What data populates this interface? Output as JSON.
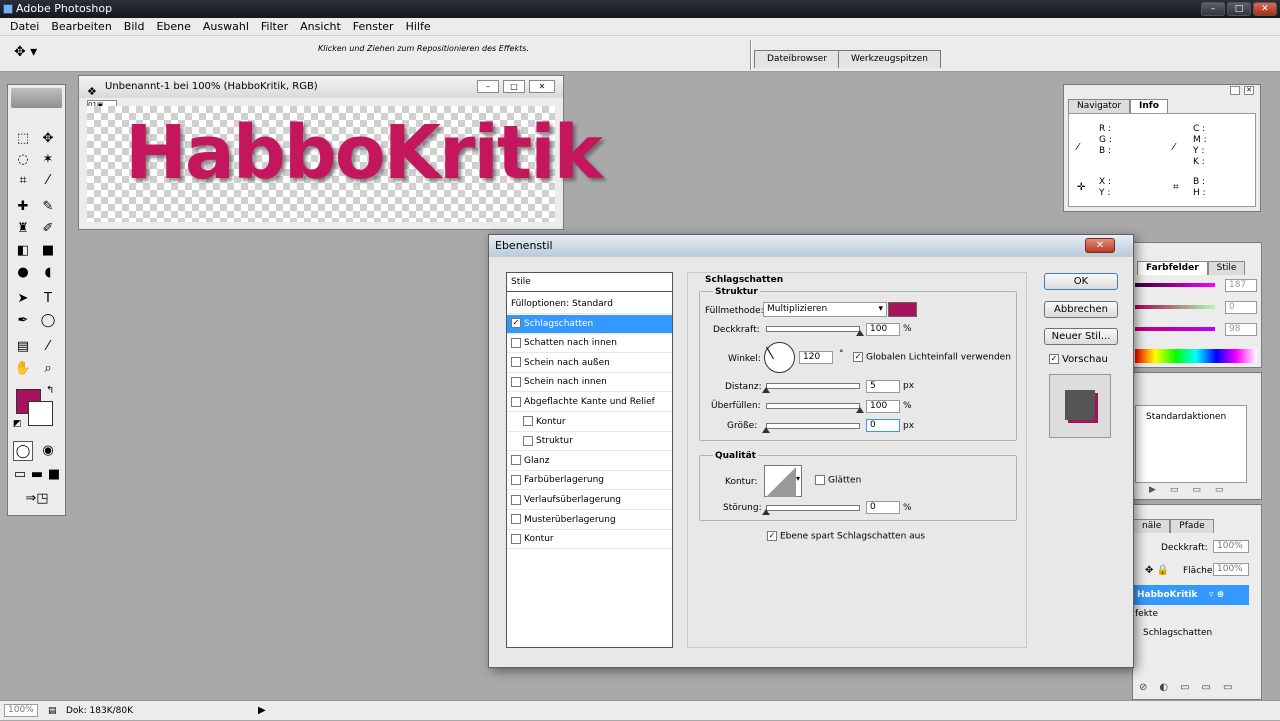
{
  "app": {
    "title": "Adobe Photoshop"
  },
  "menu": [
    "Datei",
    "Bearbeiten",
    "Bild",
    "Ebene",
    "Auswahl",
    "Filter",
    "Ansicht",
    "Fenster",
    "Hilfe"
  ],
  "options_bar": {
    "hint": "Klicken und Ziehen zum Repositionieren des Effekts.",
    "well_tabs": [
      "Dateibrowser",
      "Werkzeugspitzen"
    ]
  },
  "colors": {
    "foreground": "#a5135d",
    "background": "#ffffff",
    "accent": "#3399ff"
  },
  "document": {
    "title": "Unbenannt-1 bei 100% (HabboKritik, RGB)",
    "canvas_text": "HabboKritik"
  },
  "info_palette": {
    "tabs": [
      "Navigator",
      "Info"
    ],
    "left_rgb": [
      "R :",
      "G :",
      "B :"
    ],
    "right_cmyk": [
      "C :",
      "M :",
      "Y :",
      "K :"
    ],
    "xy": [
      "X :",
      "Y :"
    ],
    "bh": [
      "B :",
      "H :"
    ]
  },
  "color_palette": {
    "tabs": [
      "Farbfelder",
      "Stile"
    ],
    "values": [
      "187",
      "0",
      "98"
    ]
  },
  "actions_palette": {
    "item": "Standardaktionen"
  },
  "layers_palette": {
    "tabs": [
      "näle",
      "Pfade"
    ],
    "opacity_label": "Deckkraft:",
    "opacity": "100%",
    "fill_label": "Fläche",
    "fill": "100%",
    "layer_name": "HabboKritik",
    "effects_label": "fekte",
    "effect_item": "Schlagschatten"
  },
  "status_bar": {
    "zoom": "100%",
    "doc": "Dok: 183K/80K"
  },
  "dialog": {
    "title": "Ebenenstil",
    "styles_header": "Stile",
    "styles": [
      {
        "label": "Fülloptionen: Standard",
        "checkbox": false,
        "checked": false,
        "selected": false,
        "indent": false
      },
      {
        "label": "Schlagschatten",
        "checkbox": true,
        "checked": true,
        "selected": true,
        "indent": false
      },
      {
        "label": "Schatten nach innen",
        "checkbox": true,
        "checked": false,
        "selected": false,
        "indent": false
      },
      {
        "label": "Schein nach außen",
        "checkbox": true,
        "checked": false,
        "selected": false,
        "indent": false
      },
      {
        "label": "Schein nach innen",
        "checkbox": true,
        "checked": false,
        "selected": false,
        "indent": false
      },
      {
        "label": "Abgeflachte Kante und Relief",
        "checkbox": true,
        "checked": false,
        "selected": false,
        "indent": false
      },
      {
        "label": "Kontur",
        "checkbox": true,
        "checked": false,
        "selected": false,
        "indent": true
      },
      {
        "label": "Struktur",
        "checkbox": true,
        "checked": false,
        "selected": false,
        "indent": true
      },
      {
        "label": "Glanz",
        "checkbox": true,
        "checked": false,
        "selected": false,
        "indent": false
      },
      {
        "label": "Farbüberlagerung",
        "checkbox": true,
        "checked": false,
        "selected": false,
        "indent": false
      },
      {
        "label": "Verlaufsüberlagerung",
        "checkbox": true,
        "checked": false,
        "selected": false,
        "indent": false
      },
      {
        "label": "Musterüberlagerung",
        "checkbox": true,
        "checked": false,
        "selected": false,
        "indent": false
      },
      {
        "label": "Kontur",
        "checkbox": true,
        "checked": false,
        "selected": false,
        "indent": false
      }
    ],
    "section_title": "Schlagschatten",
    "struktur": {
      "title": "Struktur",
      "blend_label": "Füllmethode:",
      "blend_value": "Multiplizieren",
      "shadow_color": "#a5135d",
      "opacity_label": "Deckkraft:",
      "opacity_value": "100",
      "opacity": 1.0,
      "angle_label": "Winkel:",
      "angle_value": "120",
      "angle_unit": "°",
      "global_light_label": "Globalen Lichteinfall verwenden",
      "distance_label": "Distanz:",
      "distance_value": "5",
      "distance": 0.0,
      "spread_label": "Überfüllen:",
      "spread_value": "100",
      "spread": 1.0,
      "size_label": "Größe:",
      "size_value": "0",
      "size": 0.0,
      "unit_px": "px",
      "unit_pct": "%"
    },
    "qualitaet": {
      "title": "Qualität",
      "contour_label": "Kontur:",
      "smooth_label": "Glätten",
      "noise_label": "Störung:",
      "noise_value": "0",
      "noise": 0.0,
      "unit_pct": "%"
    },
    "knockout_label": "Ebene spart Schlagschatten aus",
    "buttons": {
      "ok": "OK",
      "cancel": "Abbrechen",
      "new_style": "Neuer Stil...",
      "preview": "Vorschau"
    }
  }
}
